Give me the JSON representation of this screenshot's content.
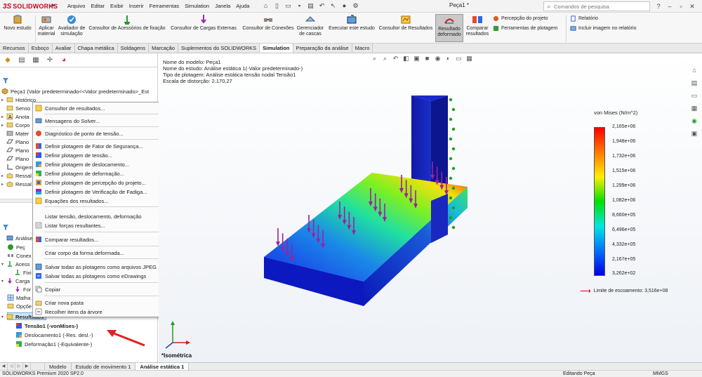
{
  "app": {
    "logo_prefix": "3S",
    "logo_text": "SOLIDWORKS",
    "menus": [
      "Arquivo",
      "Editar",
      "Exibir",
      "Inserir",
      "Ferramentas",
      "Simulation",
      "Janela",
      "Ajuda"
    ],
    "doc_title": "Peça1 *",
    "search_placeholder": "Comandos de pesquisa"
  },
  "ribbon": {
    "novo_estudo": "Novo estudo",
    "aplicar_material": "Aplicar material",
    "avaliador": "Avaliador de simulação",
    "consultor_fixacao": "Consultor de Acessórios de fixação",
    "consultor_cargas": "Consultor de Cargas Externas",
    "consultor_conexoes": "Consultor de Conexões",
    "gerenciador_cascas": "Gerenciador de cascas",
    "executar_estudo": "Executar este estudo",
    "consultor_resultados": "Consultor de Resultados",
    "resultado_deformado": "Resultado deformado",
    "comparar_resultados": "Comparar resultados",
    "percepcao_projeto": "Percepção do projeto",
    "ferramentas_plotagem": "Ferramentas de plotagem",
    "relatorio": "Relatório",
    "incluir_imagem": "Incluir imagem no relatório"
  },
  "tabs": [
    "Recursos",
    "Esboço",
    "Avaliar",
    "Chapa metálica",
    "Soldagens",
    "Marcação",
    "Suplementos do SOLIDWORKS",
    "Simulation",
    "Preparação da análise",
    "Macro"
  ],
  "active_tab": "Simulation",
  "feature_tree": {
    "root": "Peça1  (Valor predeterminado<<Valor predeterminado>_Est",
    "items": [
      "Histórico",
      "Senso",
      "Anota",
      "Corpo",
      "Mater",
      "Plano",
      "Plano",
      "Plano",
      "Origem",
      "Ressal",
      "Ressal"
    ]
  },
  "sim_tree": {
    "items": [
      "Análise es",
      "Peç",
      "Conex",
      "Acess",
      "Fixi",
      "Carga",
      "For",
      "Malha",
      "Opçõe",
      "Resultados"
    ],
    "results": [
      "Tensão1 (-vonMises-)",
      "Deslocamento1 (-Res. desl.-)",
      "Deformação1 (-Equivalente-)"
    ]
  },
  "context_menu": {
    "items": [
      "Consultor de resultados...",
      "Mensagens do Solver...",
      "Diagnóstico de ponto de tensão...",
      "Definir plotagem de Fator de Segurança...",
      "Definir plotagem de tensão...",
      "Definir plotagem de deslocamento...",
      "Definir plotagem de deformação...",
      "Definir plotagem de percepção do projeto...",
      "Definir plotagem de Verificação de Fadiga...",
      "Equações dos resultados...",
      "Listar tensão, deslocamento, deformação",
      "Listar forças resultantes...",
      "Comparar resultados...",
      "Criar corpo da forma deformada...",
      "Salvar todas as plotagens como arquivos JPEG",
      "Salvar todas as plotagens como eDrawings",
      "Copiar",
      "Criar nova pasta",
      "Recolher itens da árvore"
    ]
  },
  "viewport": {
    "info": [
      "Nome do modelo: Peça1",
      "Nome do estudo: Análise estática 1(-Valor predeterminado-)",
      "Tipo de plotagem: Análise estática tensão nodal Tensão1",
      "Escala de distorção: 2.170,27"
    ],
    "legend_title": "von Mises (N/m^2)",
    "legend_labels": [
      "2,165e+06",
      "1,948e+06",
      "1,732e+06",
      "1,515e+06",
      "1,299e+06",
      "1,082e+06",
      "8,660e+05",
      "6,496e+05",
      "4,332e+05",
      "2,167e+05",
      "3,262e+02"
    ],
    "yield": "Limite de escoamento: 3,516e+08",
    "view_name": "*Isométrica"
  },
  "bottom_tabs": [
    "Modelo",
    "Estudo de movimento 1",
    "Análise estática 1"
  ],
  "status": {
    "left": "SOLIDWORKS Premium 2020 SP2.0",
    "mid": "Editando Peça",
    "units": "MMGS"
  }
}
